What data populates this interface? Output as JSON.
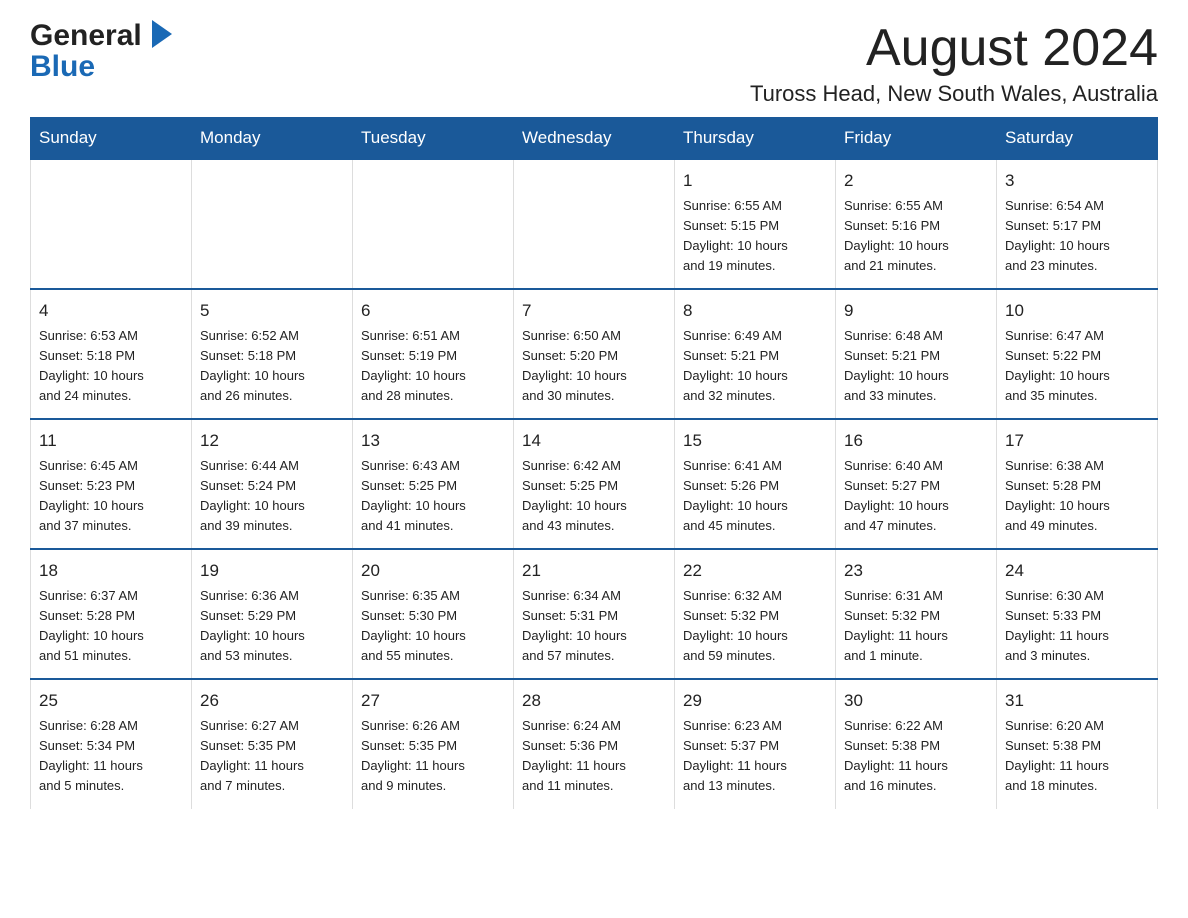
{
  "header": {
    "month_title": "August 2024",
    "location": "Tuross Head, New South Wales, Australia",
    "logo_line1": "General",
    "logo_line2": "Blue"
  },
  "calendar": {
    "headers": [
      "Sunday",
      "Monday",
      "Tuesday",
      "Wednesday",
      "Thursday",
      "Friday",
      "Saturday"
    ],
    "weeks": [
      [
        {
          "day": "",
          "info": ""
        },
        {
          "day": "",
          "info": ""
        },
        {
          "day": "",
          "info": ""
        },
        {
          "day": "",
          "info": ""
        },
        {
          "day": "1",
          "info": "Sunrise: 6:55 AM\nSunset: 5:15 PM\nDaylight: 10 hours\nand 19 minutes."
        },
        {
          "day": "2",
          "info": "Sunrise: 6:55 AM\nSunset: 5:16 PM\nDaylight: 10 hours\nand 21 minutes."
        },
        {
          "day": "3",
          "info": "Sunrise: 6:54 AM\nSunset: 5:17 PM\nDaylight: 10 hours\nand 23 minutes."
        }
      ],
      [
        {
          "day": "4",
          "info": "Sunrise: 6:53 AM\nSunset: 5:18 PM\nDaylight: 10 hours\nand 24 minutes."
        },
        {
          "day": "5",
          "info": "Sunrise: 6:52 AM\nSunset: 5:18 PM\nDaylight: 10 hours\nand 26 minutes."
        },
        {
          "day": "6",
          "info": "Sunrise: 6:51 AM\nSunset: 5:19 PM\nDaylight: 10 hours\nand 28 minutes."
        },
        {
          "day": "7",
          "info": "Sunrise: 6:50 AM\nSunset: 5:20 PM\nDaylight: 10 hours\nand 30 minutes."
        },
        {
          "day": "8",
          "info": "Sunrise: 6:49 AM\nSunset: 5:21 PM\nDaylight: 10 hours\nand 32 minutes."
        },
        {
          "day": "9",
          "info": "Sunrise: 6:48 AM\nSunset: 5:21 PM\nDaylight: 10 hours\nand 33 minutes."
        },
        {
          "day": "10",
          "info": "Sunrise: 6:47 AM\nSunset: 5:22 PM\nDaylight: 10 hours\nand 35 minutes."
        }
      ],
      [
        {
          "day": "11",
          "info": "Sunrise: 6:45 AM\nSunset: 5:23 PM\nDaylight: 10 hours\nand 37 minutes."
        },
        {
          "day": "12",
          "info": "Sunrise: 6:44 AM\nSunset: 5:24 PM\nDaylight: 10 hours\nand 39 minutes."
        },
        {
          "day": "13",
          "info": "Sunrise: 6:43 AM\nSunset: 5:25 PM\nDaylight: 10 hours\nand 41 minutes."
        },
        {
          "day": "14",
          "info": "Sunrise: 6:42 AM\nSunset: 5:25 PM\nDaylight: 10 hours\nand 43 minutes."
        },
        {
          "day": "15",
          "info": "Sunrise: 6:41 AM\nSunset: 5:26 PM\nDaylight: 10 hours\nand 45 minutes."
        },
        {
          "day": "16",
          "info": "Sunrise: 6:40 AM\nSunset: 5:27 PM\nDaylight: 10 hours\nand 47 minutes."
        },
        {
          "day": "17",
          "info": "Sunrise: 6:38 AM\nSunset: 5:28 PM\nDaylight: 10 hours\nand 49 minutes."
        }
      ],
      [
        {
          "day": "18",
          "info": "Sunrise: 6:37 AM\nSunset: 5:28 PM\nDaylight: 10 hours\nand 51 minutes."
        },
        {
          "day": "19",
          "info": "Sunrise: 6:36 AM\nSunset: 5:29 PM\nDaylight: 10 hours\nand 53 minutes."
        },
        {
          "day": "20",
          "info": "Sunrise: 6:35 AM\nSunset: 5:30 PM\nDaylight: 10 hours\nand 55 minutes."
        },
        {
          "day": "21",
          "info": "Sunrise: 6:34 AM\nSunset: 5:31 PM\nDaylight: 10 hours\nand 57 minutes."
        },
        {
          "day": "22",
          "info": "Sunrise: 6:32 AM\nSunset: 5:32 PM\nDaylight: 10 hours\nand 59 minutes."
        },
        {
          "day": "23",
          "info": "Sunrise: 6:31 AM\nSunset: 5:32 PM\nDaylight: 11 hours\nand 1 minute."
        },
        {
          "day": "24",
          "info": "Sunrise: 6:30 AM\nSunset: 5:33 PM\nDaylight: 11 hours\nand 3 minutes."
        }
      ],
      [
        {
          "day": "25",
          "info": "Sunrise: 6:28 AM\nSunset: 5:34 PM\nDaylight: 11 hours\nand 5 minutes."
        },
        {
          "day": "26",
          "info": "Sunrise: 6:27 AM\nSunset: 5:35 PM\nDaylight: 11 hours\nand 7 minutes."
        },
        {
          "day": "27",
          "info": "Sunrise: 6:26 AM\nSunset: 5:35 PM\nDaylight: 11 hours\nand 9 minutes."
        },
        {
          "day": "28",
          "info": "Sunrise: 6:24 AM\nSunset: 5:36 PM\nDaylight: 11 hours\nand 11 minutes."
        },
        {
          "day": "29",
          "info": "Sunrise: 6:23 AM\nSunset: 5:37 PM\nDaylight: 11 hours\nand 13 minutes."
        },
        {
          "day": "30",
          "info": "Sunrise: 6:22 AM\nSunset: 5:38 PM\nDaylight: 11 hours\nand 16 minutes."
        },
        {
          "day": "31",
          "info": "Sunrise: 6:20 AM\nSunset: 5:38 PM\nDaylight: 11 hours\nand 18 minutes."
        }
      ]
    ]
  }
}
